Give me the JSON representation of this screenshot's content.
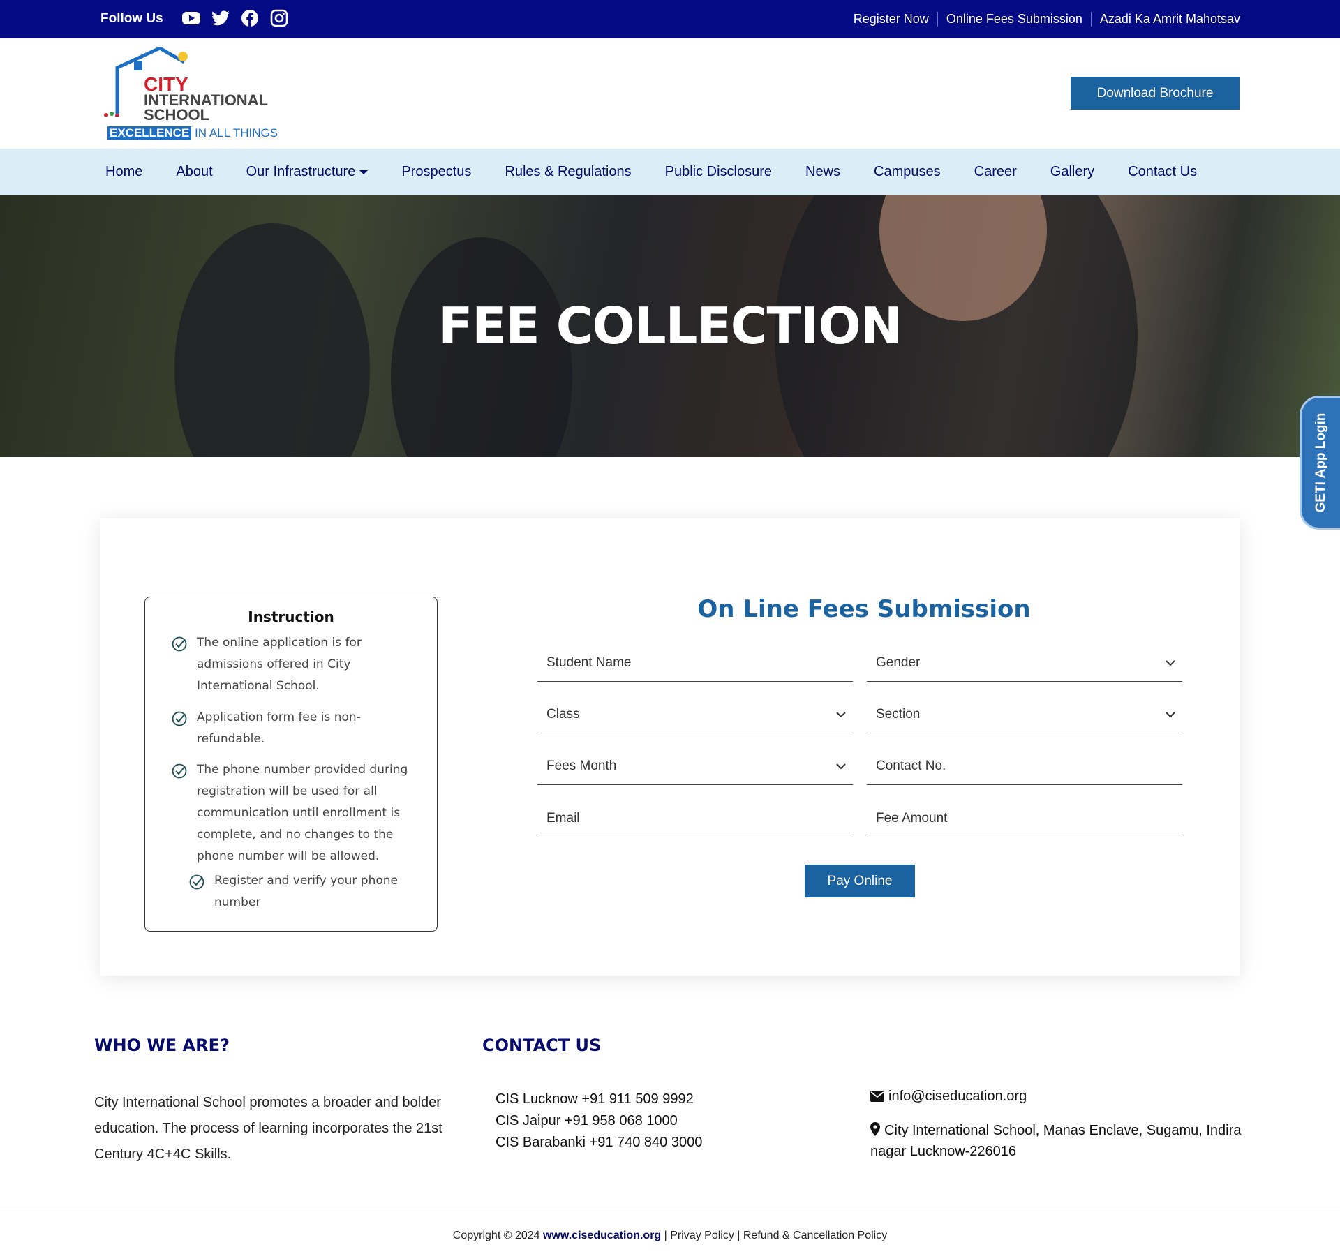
{
  "topbar": {
    "follow_label": "Follow Us",
    "social_icons": [
      "youtube-icon",
      "twitter-icon",
      "facebook-icon",
      "instagram-icon"
    ],
    "links": [
      "Register Now",
      "Online Fees Submission",
      "Azadi Ka Amrit Mahotsav"
    ]
  },
  "header": {
    "logo": {
      "line1": "CITY",
      "line2": "INTERNATIONAL",
      "line3": "SCHOOL",
      "tag_highlight": "EXCELLENCE",
      "tag_rest": "IN ALL THINGS"
    },
    "brochure_label": "Download Brochure"
  },
  "nav": {
    "items": [
      "Home",
      "About",
      "Our Infrastructure",
      "Prospectus",
      "Rules & Regulations",
      "Public Disclosure",
      "News",
      "Campuses",
      "Career",
      "Gallery",
      "Contact Us"
    ]
  },
  "hero": {
    "title": "FEE COLLECTION"
  },
  "side_tab": {
    "label": "GETI App Login"
  },
  "instructions": {
    "title": "Instruction",
    "items": [
      "The online application is for admissions offered in City International School.",
      "Application form fee is non-refundable.",
      "The phone number provided during registration will be used for all communication until enrollment is complete, and no changes to the phone number will be allowed.",
      "Register and verify your phone number"
    ]
  },
  "form": {
    "title": "On Line Fees Submission",
    "student_name": "Student Name",
    "gender": "Gender",
    "class": "Class",
    "section": "Section",
    "fees_month": "Fees Month",
    "contact_no": "Contact No.",
    "email": "Email",
    "fee_amount": "Fee Amount",
    "pay_label": "Pay Online"
  },
  "footer": {
    "who_title": "WHO WE ARE?",
    "who_text": "City International School promotes a broader and bolder education. The process of learning incorporates the 21st Century 4C+4C Skills.",
    "contact_title": "CONTACT US",
    "phones": [
      "CIS Lucknow +91 911 509 9992",
      "CIS Jaipur +91 958 068 1000",
      "CIS Barabanki +91 740 840 3000"
    ],
    "email": "info@ciseducation.org",
    "address": "City International School, Manas Enclave, Sugamu, Indira nagar Lucknow-226016",
    "copyright_prefix": "Copyright © 2024",
    "site": "www.ciseducation.org",
    "privacy": "Privay Policy",
    "refund": "Refund & Cancellation Policy"
  },
  "colors": {
    "topbar": "#050a85",
    "nav_bg": "#dbeef8",
    "accent": "#1a62a0",
    "heading": "#050a6b"
  }
}
